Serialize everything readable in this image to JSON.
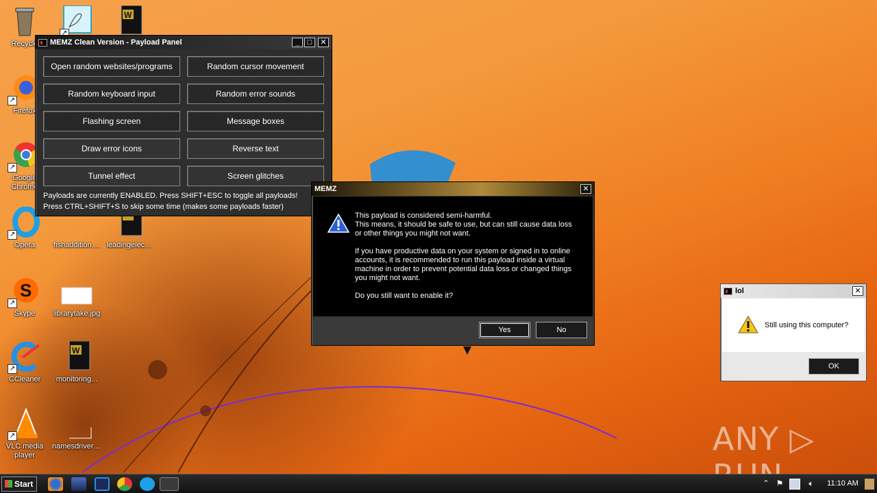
{
  "desktop": {
    "icons": [
      {
        "label": "Recycle",
        "icon": "recycle-bin-icon"
      },
      {
        "label": "",
        "icon": "pdf-document-icon"
      },
      {
        "label": "",
        "icon": "word-document-icon"
      },
      {
        "label": "Firefox",
        "icon": "firefox-icon"
      },
      {
        "label": "Google Chrome",
        "icon": "chrome-icon"
      },
      {
        "label": "Opera",
        "icon": "opera-icon"
      },
      {
        "label": "fishaddition....",
        "icon": "document-icon"
      },
      {
        "label": "leadingelec...",
        "icon": "word-document-icon"
      },
      {
        "label": "Skype",
        "icon": "skype-icon"
      },
      {
        "label": "librarytake.jpg",
        "icon": "image-file-icon"
      },
      {
        "label": "CCleaner",
        "icon": "ccleaner-icon"
      },
      {
        "label": "monitoring...",
        "icon": "word-document-icon"
      },
      {
        "label": "VLC media player",
        "icon": "vlc-icon"
      },
      {
        "label": "namesdriver....",
        "icon": "document-icon"
      }
    ],
    "watermark": "ANY ▷ RUN"
  },
  "payload_panel": {
    "title": "MEMZ Clean Version - Payload Panel",
    "buttons": [
      "Open random websites/programs",
      "Random cursor movement",
      "Random keyboard input",
      "Random error sounds",
      "Flashing screen",
      "Message boxes",
      "Draw error icons",
      "Reverse text",
      "Tunnel effect",
      "Screen glitches"
    ],
    "status_line1": "Payloads are currently ENABLED. Press SHIFT+ESC to toggle all payloads!",
    "status_line2": "Press CTRL+SHIFT+S to skip some time (makes some payloads faster)"
  },
  "memz_dialog": {
    "title": "MEMZ",
    "para1_l1": "This payload is considered semi-harmful.",
    "para1_l2": "This means, it should be safe to use, but can still cause data loss",
    "para1_l3": "or other things you might not want.",
    "para2_l1": "If you have productive data on your system or signed in to online",
    "para2_l2": "accounts, it is recommended to run this payload inside a virtual",
    "para2_l3": "machine in order to prevent potential data loss or changed things",
    "para2_l4": "you might not want.",
    "question": "Do you still want to enable it?",
    "yes_label": "Yes",
    "no_label": "No"
  },
  "lol_dialog": {
    "title": "lol",
    "message": "Still using this computer?",
    "ok_label": "OK"
  },
  "taskbar": {
    "start_label": "Start",
    "clock": "11:10 AM"
  }
}
